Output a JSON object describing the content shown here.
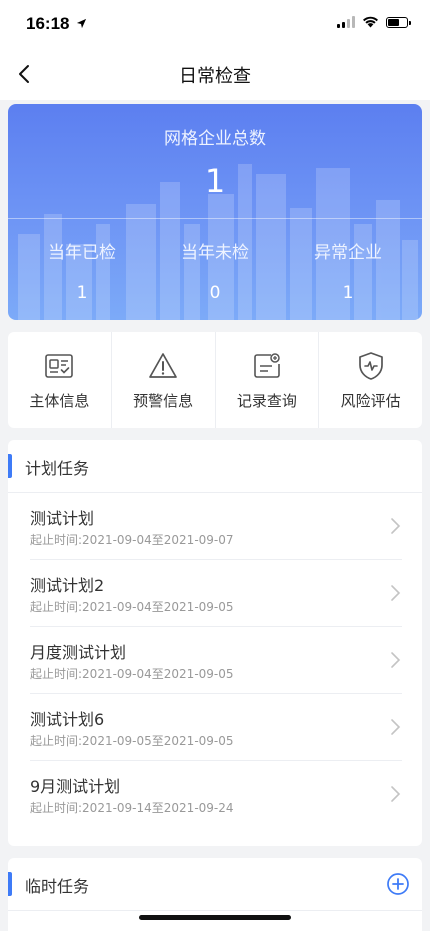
{
  "status_bar": {
    "time": "16:18",
    "icons": [
      "location-arrow-icon",
      "signal-icon",
      "wifi-icon",
      "battery-icon"
    ]
  },
  "nav": {
    "title": "日常检查",
    "back_icon": "chevron-left-icon"
  },
  "banner": {
    "title": "网格企业总数",
    "total": "1",
    "stats": [
      {
        "label": "当年已检",
        "value": "1"
      },
      {
        "label": "当年未检",
        "value": "0"
      },
      {
        "label": "异常企业",
        "value": "1"
      }
    ],
    "gradient_top": "#5c7ff0",
    "gradient_bottom": "#7caaf8"
  },
  "quick_menu": [
    {
      "label": "主体信息",
      "icon": "id-card-icon"
    },
    {
      "label": "预警信息",
      "icon": "warning-triangle-icon"
    },
    {
      "label": "记录查询",
      "icon": "record-search-icon"
    },
    {
      "label": "风险评估",
      "icon": "shield-icon"
    }
  ],
  "plan_tasks": {
    "title": "计划任务",
    "items": [
      {
        "name": "测试计划",
        "time": "起止时间:2021-09-04至2021-09-07"
      },
      {
        "name": "测试计划2",
        "time": "起止时间:2021-09-04至2021-09-05"
      },
      {
        "name": "月度测试计划",
        "time": "起止时间:2021-09-04至2021-09-05"
      },
      {
        "name": "测试计划6",
        "time": "起止时间:2021-09-05至2021-09-05"
      },
      {
        "name": "9月测试计划",
        "time": "起止时间:2021-09-14至2021-09-24"
      }
    ]
  },
  "temp_tasks": {
    "title": "临时任务",
    "add_icon": "plus-circle-icon"
  },
  "colors": {
    "accent": "#3e7bf7",
    "background": "#f2f3f5",
    "icon_gray": "#555555"
  }
}
